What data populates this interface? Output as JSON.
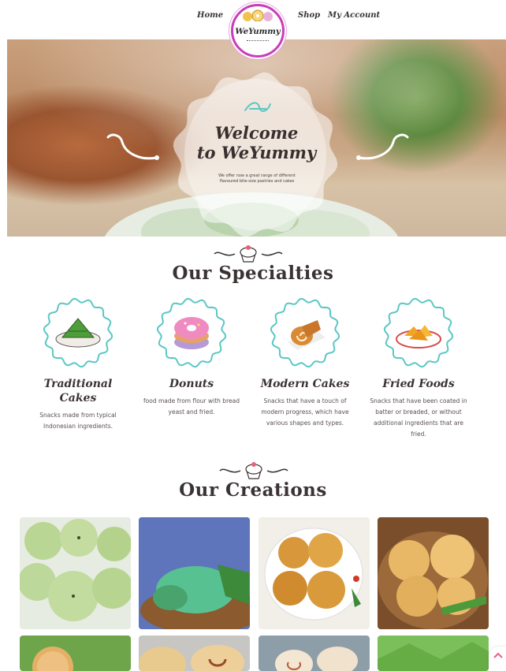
{
  "nav": {
    "home": "Home",
    "shop": "Shop",
    "account": "My Account",
    "logo_text": "WeYummy"
  },
  "hero": {
    "title_line1": "Welcome",
    "title_line2": "to WeYummy",
    "subtitle": "We offer now a great range of different flavoured bite-size pastries and cakes"
  },
  "specialties": {
    "heading": "Our Specialties",
    "items": [
      {
        "name": "Traditional Cakes",
        "desc": "Snacks made from typical Indonesian ingredients.",
        "icon": "kue-icon"
      },
      {
        "name": "Donuts",
        "desc": "food made from flour with bread yeast and fried.",
        "icon": "donut-icon"
      },
      {
        "name": "Modern Cakes",
        "desc": "Snacks that have a touch of modern progress, which have various shapes and types.",
        "icon": "roll-cake-icon"
      },
      {
        "name": "Fried Foods",
        "desc": "Snacks that have been coated in batter or breaded, or without additional ingredients that are fried.",
        "icon": "fried-food-icon"
      }
    ]
  },
  "creations": {
    "heading": "Our Creations"
  },
  "colors": {
    "accent_pink": "#c63fb9",
    "teal": "#5bc7c4",
    "text_dark": "#3b3333"
  }
}
